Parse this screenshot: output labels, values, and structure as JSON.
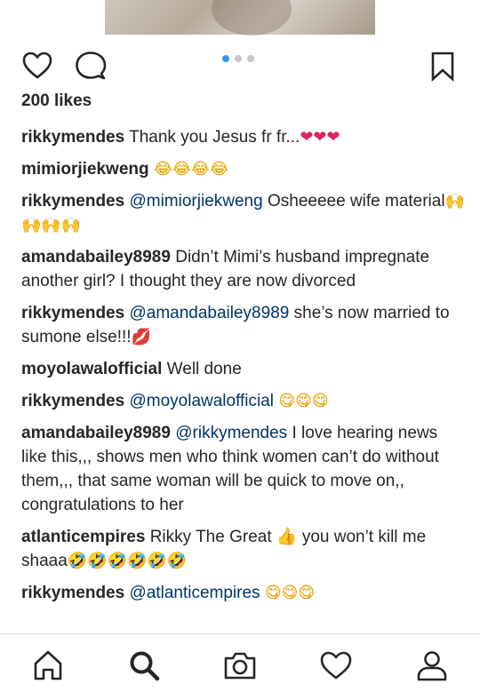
{
  "post": {
    "likes": "200 likes",
    "carousel_dots": 3,
    "active_dot": 0
  },
  "comments": [
    {
      "user": "rikkymendes",
      "mention": "",
      "text": "Thank you Jesus fr fr...",
      "emoji": "❤❤❤",
      "emoji_style": "heart"
    },
    {
      "user": "mimiorjiekweng",
      "mention": "",
      "text": "",
      "emoji": "😂😂😂😂",
      "emoji_style": "yellow"
    },
    {
      "user": "rikkymendes",
      "mention": "@mimiorjiekweng",
      "text": "Osheeeee wife material",
      "emoji": "🙌🙌🙌🙌",
      "emoji_style": "yellow"
    },
    {
      "user": "amandabailey8989",
      "mention": "",
      "text": "Didn’t Mimi’s husband impregnate another girl? I thought they are now divorced",
      "emoji": "",
      "emoji_style": ""
    },
    {
      "user": "rikkymendes",
      "mention": "@amandabailey8989",
      "text": "she’s now married to sumone else!!!",
      "emoji": "💋",
      "emoji_style": "heart"
    },
    {
      "user": "moyolawalofficial",
      "mention": "",
      "text": "Well done",
      "emoji": "",
      "emoji_style": ""
    },
    {
      "user": "rikkymendes",
      "mention": "@moyolawalofficial",
      "text": "",
      "emoji": "😋😋😋",
      "emoji_style": "yellow"
    },
    {
      "user": "amandabailey8989",
      "mention": "@rikkymendes",
      "text": "I love hearing news like this,,, shows men who think women can’t do without them,,, that same woman will be quick to move on,, congratulations to her",
      "emoji": "",
      "emoji_style": ""
    },
    {
      "user": "atlanticempires",
      "mention": "",
      "text": "Rikky The Great 👍 you won’t kill me shaaa",
      "emoji": "🤣🤣🤣🤣🤣🤣",
      "emoji_style": "yellow"
    },
    {
      "user": "rikkymendes",
      "mention": "@atlanticempires",
      "text": "",
      "emoji": "😋😋😋",
      "emoji_style": "yellow"
    }
  ],
  "icons": {
    "like": "heart-icon",
    "comment": "speech-bubble-icon",
    "save": "bookmark-icon",
    "nav": [
      "home-icon",
      "search-icon",
      "camera-icon",
      "activity-heart-icon",
      "profile-icon"
    ]
  },
  "colors": {
    "text": "#262626",
    "mention": "#003569",
    "active_dot": "#3897f0",
    "inactive_dot": "#c7c7c7",
    "divider": "#dbdbdb"
  }
}
